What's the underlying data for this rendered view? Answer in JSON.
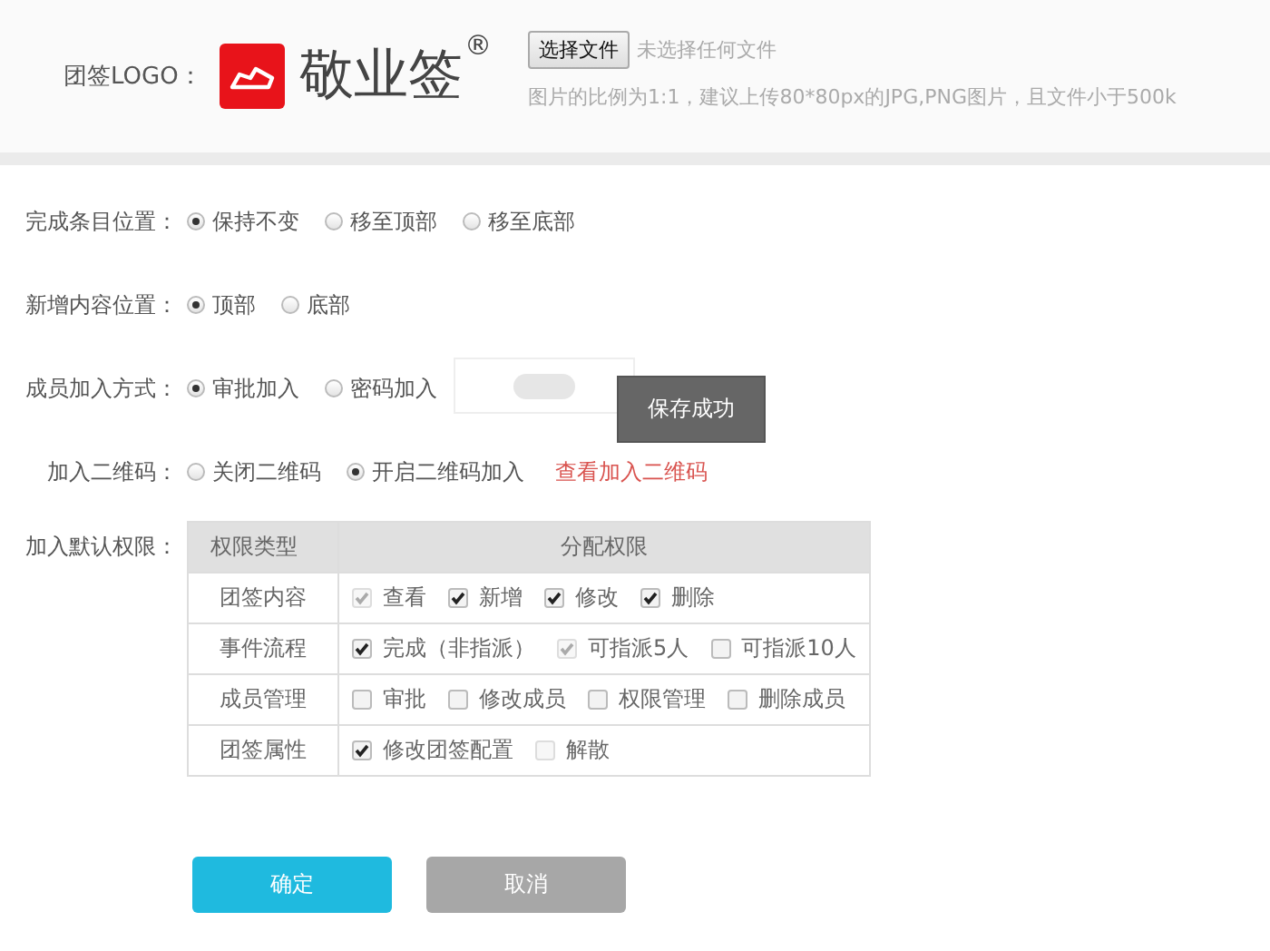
{
  "logo_section": {
    "label": "团签LOGO：",
    "brand": "敬业签",
    "registered": "®",
    "file_button": "选择文件",
    "file_status": "未选择任何文件",
    "hint": "图片的比例为1:1，建议上传80*80px的JPG,PNG图片，且文件小于500k"
  },
  "settings": [
    {
      "label": "完成条目位置：",
      "options": [
        {
          "label": "保持不变",
          "selected": true
        },
        {
          "label": "移至顶部",
          "selected": false
        },
        {
          "label": "移至底部",
          "selected": false
        }
      ]
    },
    {
      "label": "新增内容位置：",
      "options": [
        {
          "label": "顶部",
          "selected": true
        },
        {
          "label": "底部",
          "selected": false
        }
      ]
    },
    {
      "label": "成员加入方式：",
      "options": [
        {
          "label": "审批加入",
          "selected": true
        },
        {
          "label": "密码加入",
          "selected": false
        }
      ],
      "toggle": true
    },
    {
      "label": "加入二维码：",
      "options": [
        {
          "label": "关闭二维码",
          "selected": false
        },
        {
          "label": "开启二维码加入",
          "selected": true
        }
      ],
      "link": "查看加入二维码"
    }
  ],
  "toast": "保存成功",
  "permissions": {
    "label": "加入默认权限：",
    "columns": [
      "权限类型",
      "分配权限"
    ],
    "rows": [
      {
        "type": "团签内容",
        "options": [
          {
            "label": "查看",
            "checked": true,
            "disabled": true
          },
          {
            "label": "新增",
            "checked": true,
            "disabled": false
          },
          {
            "label": "修改",
            "checked": true,
            "disabled": false
          },
          {
            "label": "删除",
            "checked": true,
            "disabled": false
          }
        ]
      },
      {
        "type": "事件流程",
        "options": [
          {
            "label": "完成（非指派）",
            "checked": true,
            "disabled": false
          },
          {
            "label": "可指派5人",
            "checked": true,
            "disabled": true
          },
          {
            "label": "可指派10人",
            "checked": false,
            "disabled": false
          }
        ]
      },
      {
        "type": "成员管理",
        "options": [
          {
            "label": "审批",
            "checked": false,
            "disabled": false
          },
          {
            "label": "修改成员",
            "checked": false,
            "disabled": false
          },
          {
            "label": "权限管理",
            "checked": false,
            "disabled": false
          },
          {
            "label": "删除成员",
            "checked": false,
            "disabled": false
          }
        ]
      },
      {
        "type": "团签属性",
        "options": [
          {
            "label": "修改团签配置",
            "checked": true,
            "disabled": false
          },
          {
            "label": "解散",
            "checked": false,
            "disabled": true
          }
        ]
      }
    ]
  },
  "buttons": [
    {
      "label": "确定",
      "kind": "primary"
    },
    {
      "label": "取消",
      "kind": "secondary"
    }
  ]
}
